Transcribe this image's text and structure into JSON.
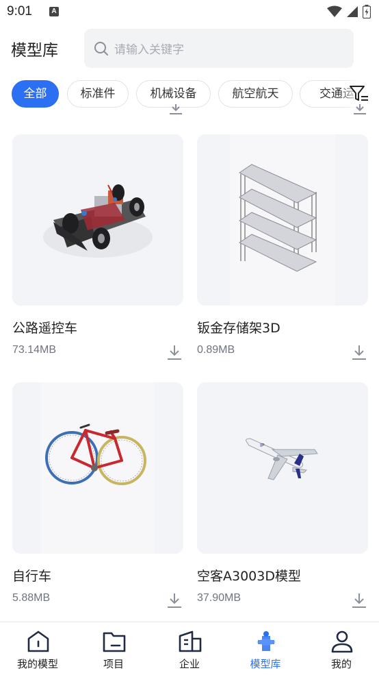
{
  "status": {
    "time": "9:01",
    "badge": "A"
  },
  "header": {
    "title": "模型库",
    "search_placeholder": "请输入关键字"
  },
  "filters": [
    "全部",
    "标准件",
    "机械设备",
    "航空航天",
    "交通运"
  ],
  "active_filter": "全部",
  "models": [
    {
      "name": "公路遥控车",
      "size": "73.14MB",
      "thumb": "rc-car"
    },
    {
      "name": "钣金存储架3D",
      "size": "0.89MB",
      "thumb": "metal-shelf"
    },
    {
      "name": "自行车",
      "size": "5.88MB",
      "thumb": "bicycle"
    },
    {
      "name": "空客A3003D模型",
      "size": "37.90MB",
      "thumb": "airplane"
    }
  ],
  "tabbar": {
    "items": [
      {
        "label": "我的模型",
        "icon": "home-icon"
      },
      {
        "label": "项目",
        "icon": "folder-icon"
      },
      {
        "label": "企业",
        "icon": "building-icon"
      },
      {
        "label": "模型库",
        "icon": "model-library-icon"
      },
      {
        "label": "我的",
        "icon": "user-icon"
      }
    ],
    "active": "模型库"
  },
  "colors": {
    "accent": "#2b6ff2",
    "chip_border": "#e1e3e8",
    "card_bg": "#f3f4f7"
  }
}
